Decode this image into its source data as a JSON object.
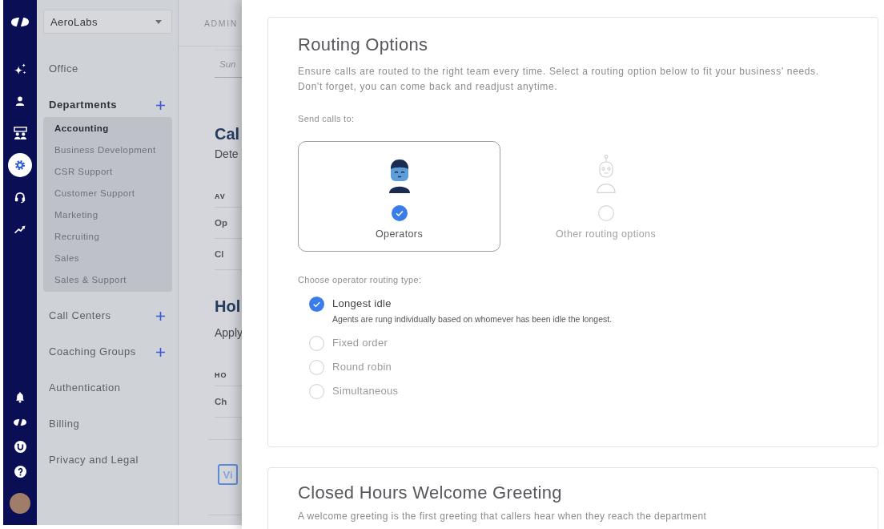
{
  "rail": {
    "items": [
      {
        "kind": "sparkle",
        "selected": false
      },
      {
        "kind": "person",
        "selected": false
      },
      {
        "kind": "team",
        "selected": false
      },
      {
        "kind": "gear",
        "selected": true
      },
      {
        "kind": "headset",
        "selected": false
      },
      {
        "kind": "trend",
        "selected": false
      }
    ],
    "bottom_items": [
      {
        "kind": "bell"
      },
      {
        "kind": "logo"
      },
      {
        "kind": "emblem"
      },
      {
        "kind": "help"
      },
      {
        "kind": "avatar"
      }
    ]
  },
  "sidebar": {
    "org_select": {
      "value": "AeroLabs"
    },
    "sections": [
      {
        "label": "Office",
        "expanded": false,
        "add_button": false
      },
      {
        "label": "Departments",
        "expanded": true,
        "add_button": true,
        "children": [
          {
            "label": "Accounting",
            "selected": true
          },
          {
            "label": "Business Development",
            "selected": false
          },
          {
            "label": "CSR Support",
            "selected": false
          },
          {
            "label": "Customer Support",
            "selected": false
          },
          {
            "label": "Marketing",
            "selected": false
          },
          {
            "label": "Recruiting",
            "selected": false
          },
          {
            "label": "Sales",
            "selected": false
          },
          {
            "label": "Sales & Support",
            "selected": false
          }
        ]
      },
      {
        "label": "Call Centers",
        "expanded": false,
        "add_button": true
      },
      {
        "label": "Coaching Groups",
        "expanded": false,
        "add_button": true
      },
      {
        "label": "Authentication",
        "expanded": false,
        "add_button": false
      },
      {
        "label": "Billing",
        "expanded": false,
        "add_button": false
      },
      {
        "label": "Privacy and Legal",
        "expanded": false,
        "add_button": false
      }
    ]
  },
  "main": {
    "breadcrumb": "ADMIN",
    "field": {
      "placeholder": "Sun"
    },
    "sections": [
      {
        "title": "Cal",
        "description": "Dete",
        "column_1": "AV",
        "rows": [
          "Op",
          "Cl"
        ]
      },
      {
        "title": "Hol",
        "description": "Apply",
        "column_1": "HO",
        "rows": [
          "Ch"
        ]
      }
    ],
    "tile": "Vi"
  },
  "drawer": {
    "routing_card": {
      "title": "Routing Options",
      "description": "Ensure calls are routed to the right team every time. Select a routing option below to fit your business' needs. Don't forget, you can come back and readjust anytime.",
      "send_label": "Send calls to:",
      "targets": [
        {
          "kind": "person",
          "label": "Operators",
          "selected": true
        },
        {
          "kind": "robot",
          "label": "Other routing options",
          "selected": false
        }
      ],
      "type_label": "Choose operator routing type:",
      "types": [
        {
          "label": "Longest idle",
          "selected": true,
          "description": "Agents are rung individually based on whomever has been idle the longest."
        },
        {
          "label": "Fixed order",
          "selected": false
        },
        {
          "label": "Round robin",
          "selected": false
        },
        {
          "label": "Simultaneous",
          "selected": false
        }
      ]
    },
    "greeting_card": {
      "title": "Closed Hours Welcome Greeting",
      "description": "A welcome greeting is the first greeting that callers hear when they reach the department"
    }
  }
}
